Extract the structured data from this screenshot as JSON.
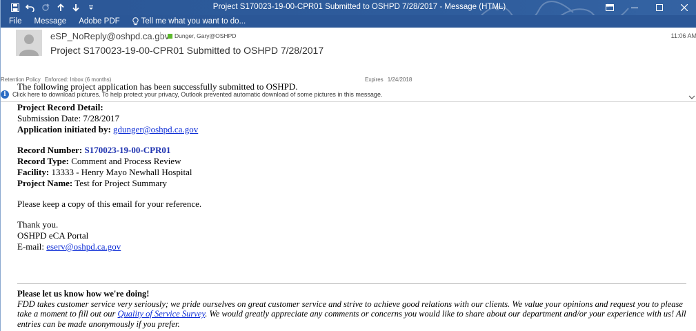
{
  "window": {
    "title": "Project S170023-19-00-CPR01 Submitted to OSHPD 7/28/2017 - Message (HTML)",
    "qat_icons": [
      "save-icon",
      "undo-icon",
      "redo-icon",
      "up-arrow-icon",
      "down-arrow-icon",
      "customize-icon"
    ],
    "controls": [
      "ribbon-display-icon",
      "minimize-icon",
      "maximize-icon",
      "close-icon"
    ],
    "accent": "#2b5797"
  },
  "ribbon": {
    "tabs": [
      "File",
      "Message",
      "Adobe PDF"
    ],
    "tell_me": "Tell me what you want to do..."
  },
  "header": {
    "sender": "eSP_NoReply@oshpd.ca.gov",
    "recipient": "Dunger, Gary@OSHPD",
    "time": "11:06 AM",
    "subject": "Project S170023-19-00-CPR01 Submitted to OSHPD 7/28/2017",
    "retention_label": "Retention Policy",
    "retention_value": "Enforced: Inbox (6 months)",
    "expires_label": "Expires",
    "expires_value": "1/24/2018",
    "info_text": "Click here to download pictures. To help protect your privacy, Outlook prevented automatic download of some pictures in this message."
  },
  "body": {
    "intro": "The following project application has been successfully submitted to OSHPD.",
    "record_detail_heading": "Project Record Detail:",
    "submission_date": "Submission Date: 7/28/2017",
    "initiated_label": "Application initiated by:",
    "initiated_email": "gdunger@oshpd.ca.gov",
    "record_number_label": "Record Number:",
    "record_number": "S170023-19-00-CPR01",
    "record_type_label": "Record Type:",
    "record_type": "Comment and Process Review",
    "facility_label": "Facility:",
    "facility": "13333 - Henry Mayo Newhall Hospital",
    "project_name_label": "Project Name:",
    "project_name": "Test for Project Summary",
    "keep_copy": "Please keep a copy of this email for your reference.",
    "thanks": "Thank you.",
    "portal": "OSHPD eCA Portal",
    "email_label": "E-mail:",
    "email": "eserv@oshpd.ca.gov"
  },
  "feedback": {
    "heading": "Please let us know how we're doing!",
    "text_before": "FDD takes customer service very seriously; we pride ourselves on great customer service and strive to achieve good relations with our clients. We value your opinions and request you to please take a moment to fill out our",
    "link": "Quality of Service Survey",
    "text_after": ". We would greatly appreciate any comments or concerns you would like to share about our department and/or your experience with us! All entries can be made anonymously if you prefer."
  }
}
